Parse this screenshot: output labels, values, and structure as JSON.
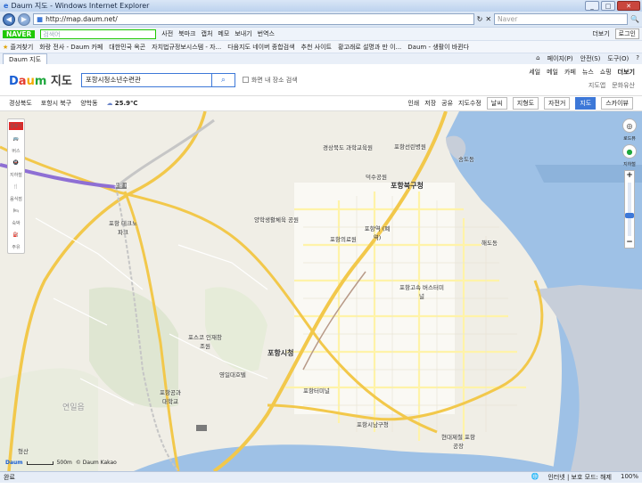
{
  "window": {
    "title": "Daum 지도 - Windows Internet Explorer"
  },
  "browser": {
    "url": "http://map.daum.net/",
    "search_placeholder": "Naver",
    "toolbar": {
      "naver_label": "NAVER",
      "naver_search_placeholder": "검색어",
      "items": [
        "사전",
        "북마크",
        "캡처",
        "메모",
        "보내기",
        "번역스"
      ],
      "more": "더보기",
      "login": "로그인"
    },
    "favorites": {
      "label": "즐겨찾기",
      "items": [
        "화랑 전사 - Daum 카페",
        "대한민국 옥곤",
        "자치법규정보시스템 - 자...",
        "다음지도 네이버 종합검색",
        "추천 사이트",
        "황고래로 설명과 만 이...",
        "Daum - 생활이 바뀐다"
      ]
    },
    "tab": {
      "label": "Daum 지도"
    },
    "tab_tools": [
      "페이지(P)",
      "안전(S)",
      "도구(O)"
    ]
  },
  "daum": {
    "logo_text": {
      "d": "D",
      "a": "a",
      "u": "u",
      "m": "m",
      "rest": " 지도"
    },
    "query": "포항시청소년수련관",
    "checkbox_label": "화면 내 장소 검색",
    "header_links": [
      "세일",
      "메일",
      "카페",
      "뉴스",
      "쇼핑",
      "더보기"
    ],
    "header_links2": [
      "지도앱",
      "문화유산"
    ],
    "location": [
      "경상북도",
      "포항시 북구",
      "양학동"
    ],
    "temperature": "25.9℃",
    "map_tools": [
      "인쇄",
      "저장",
      "공유",
      "지도수정",
      "날씨",
      "지형도",
      "자전거"
    ],
    "modes": [
      "지도",
      "스카이뷰"
    ],
    "active_mode": "지도"
  },
  "map": {
    "labels": [
      {
        "text": "포항선린병원",
        "kind": "poi"
      },
      {
        "text": "경상북도 과학교육원",
        "kind": "poi"
      },
      {
        "text": "덕수공원",
        "kind": "poi"
      },
      {
        "text": "포항북구청",
        "kind": "big"
      },
      {
        "text": "포항역 (폐역)",
        "kind": "poi"
      },
      {
        "text": "양학생활체육 공원",
        "kind": "poi"
      },
      {
        "text": "포항의료원",
        "kind": "poi"
      },
      {
        "text": "포항 테크노파크",
        "kind": "poi"
      },
      {
        "text": "포항고속 버스터미널",
        "kind": "poi"
      },
      {
        "text": "포스코 인재창조원",
        "kind": "poi"
      },
      {
        "text": "포항시청",
        "kind": "big"
      },
      {
        "text": "영일대호텔",
        "kind": "poi"
      },
      {
        "text": "포항공과 대학교",
        "kind": "poi"
      },
      {
        "text": "포항터미널",
        "kind": "poi"
      },
      {
        "text": "포항시남구청",
        "kind": "poi"
      },
      {
        "text": "현대제철 포항공장",
        "kind": "poi"
      },
      {
        "text": "송도동",
        "kind": "poi"
      },
      {
        "text": "해도동",
        "kind": "poi"
      },
      {
        "text": "연일읍",
        "kind": "area"
      },
      {
        "text": "형산",
        "kind": "poi"
      },
      {
        "text": "포항 IC",
        "kind": "poi"
      }
    ],
    "left_tools": [
      "길찾기",
      "버스",
      "지하철",
      "음식점",
      "숙박",
      "주유"
    ],
    "right_tools": [
      "로드뷰",
      "지하철"
    ],
    "scale": "500m",
    "copyright": "© Daum Kakao"
  },
  "status": {
    "left": "완료",
    "zone": "인터넷 | 보호 모드: 해제",
    "zoom": "100%"
  }
}
